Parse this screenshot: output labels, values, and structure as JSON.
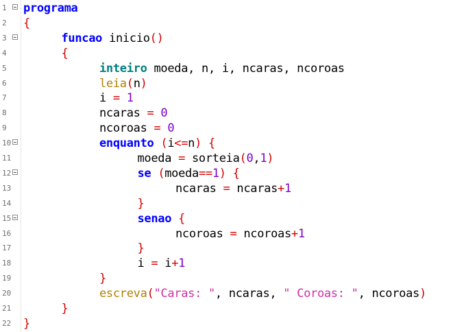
{
  "editor": {
    "colors": {
      "keyword": "#0000ff",
      "type": "#008080",
      "builtin_function": "#b08000",
      "number": "#7b00c8",
      "string": "#d12ea6",
      "operator_bracket": "#d00000",
      "identifier": "#000000",
      "line_number": "#6f6f6f"
    },
    "lines": [
      {
        "no": "1",
        "fold": true,
        "indent": 0,
        "tokens": [
          {
            "t": "kw",
            "v": "programa"
          }
        ]
      },
      {
        "no": "2",
        "fold": false,
        "indent": 0,
        "tokens": [
          {
            "t": "br",
            "v": "{"
          }
        ]
      },
      {
        "no": "3",
        "fold": true,
        "indent": 1,
        "tokens": [
          {
            "t": "kw",
            "v": "funcao"
          },
          {
            "t": "pl",
            "v": " "
          },
          {
            "t": "id",
            "v": "inicio"
          },
          {
            "t": "br",
            "v": "()"
          }
        ]
      },
      {
        "no": "4",
        "fold": false,
        "indent": 1,
        "tokens": [
          {
            "t": "br",
            "v": "{"
          }
        ]
      },
      {
        "no": "5",
        "fold": false,
        "indent": 2,
        "tokens": [
          {
            "t": "ty",
            "v": "inteiro"
          },
          {
            "t": "pl",
            "v": " "
          },
          {
            "t": "id",
            "v": "moeda"
          },
          {
            "t": "pl",
            "v": ", "
          },
          {
            "t": "id",
            "v": "n"
          },
          {
            "t": "pl",
            "v": ", "
          },
          {
            "t": "id",
            "v": "i"
          },
          {
            "t": "pl",
            "v": ", "
          },
          {
            "t": "id",
            "v": "ncaras"
          },
          {
            "t": "pl",
            "v": ", "
          },
          {
            "t": "id",
            "v": "ncoroas"
          }
        ]
      },
      {
        "no": "6",
        "fold": false,
        "indent": 2,
        "tokens": [
          {
            "t": "fn",
            "v": "leia"
          },
          {
            "t": "br",
            "v": "("
          },
          {
            "t": "id",
            "v": "n"
          },
          {
            "t": "br",
            "v": ")"
          }
        ]
      },
      {
        "no": "7",
        "fold": false,
        "indent": 2,
        "tokens": [
          {
            "t": "id",
            "v": "i"
          },
          {
            "t": "pl",
            "v": " "
          },
          {
            "t": "op",
            "v": "="
          },
          {
            "t": "pl",
            "v": " "
          },
          {
            "t": "num",
            "v": "1"
          }
        ]
      },
      {
        "no": "8",
        "fold": false,
        "indent": 2,
        "tokens": [
          {
            "t": "id",
            "v": "ncaras"
          },
          {
            "t": "pl",
            "v": " "
          },
          {
            "t": "op",
            "v": "="
          },
          {
            "t": "pl",
            "v": " "
          },
          {
            "t": "num",
            "v": "0"
          }
        ]
      },
      {
        "no": "9",
        "fold": false,
        "indent": 2,
        "tokens": [
          {
            "t": "id",
            "v": "ncoroas"
          },
          {
            "t": "pl",
            "v": " "
          },
          {
            "t": "op",
            "v": "="
          },
          {
            "t": "pl",
            "v": " "
          },
          {
            "t": "num",
            "v": "0"
          }
        ]
      },
      {
        "no": "10",
        "fold": true,
        "indent": 2,
        "tokens": [
          {
            "t": "kw",
            "v": "enquanto"
          },
          {
            "t": "pl",
            "v": " "
          },
          {
            "t": "br",
            "v": "("
          },
          {
            "t": "id",
            "v": "i"
          },
          {
            "t": "op",
            "v": "<="
          },
          {
            "t": "id",
            "v": "n"
          },
          {
            "t": "br",
            "v": ")"
          },
          {
            "t": "pl",
            "v": " "
          },
          {
            "t": "br",
            "v": "{"
          }
        ]
      },
      {
        "no": "11",
        "fold": false,
        "indent": 3,
        "tokens": [
          {
            "t": "id",
            "v": "moeda"
          },
          {
            "t": "pl",
            "v": " "
          },
          {
            "t": "op",
            "v": "="
          },
          {
            "t": "pl",
            "v": " "
          },
          {
            "t": "id",
            "v": "sorteia"
          },
          {
            "t": "br",
            "v": "("
          },
          {
            "t": "num",
            "v": "0"
          },
          {
            "t": "pl",
            "v": ","
          },
          {
            "t": "num",
            "v": "1"
          },
          {
            "t": "br",
            "v": ")"
          }
        ]
      },
      {
        "no": "12",
        "fold": true,
        "indent": 3,
        "tokens": [
          {
            "t": "kw",
            "v": "se"
          },
          {
            "t": "pl",
            "v": " "
          },
          {
            "t": "br",
            "v": "("
          },
          {
            "t": "id",
            "v": "moeda"
          },
          {
            "t": "op",
            "v": "=="
          },
          {
            "t": "num",
            "v": "1"
          },
          {
            "t": "br",
            "v": ")"
          },
          {
            "t": "pl",
            "v": " "
          },
          {
            "t": "br",
            "v": "{"
          }
        ]
      },
      {
        "no": "13",
        "fold": false,
        "indent": 4,
        "tokens": [
          {
            "t": "id",
            "v": "ncaras"
          },
          {
            "t": "pl",
            "v": " "
          },
          {
            "t": "op",
            "v": "="
          },
          {
            "t": "pl",
            "v": " "
          },
          {
            "t": "id",
            "v": "ncaras"
          },
          {
            "t": "op",
            "v": "+"
          },
          {
            "t": "num",
            "v": "1"
          }
        ]
      },
      {
        "no": "14",
        "fold": false,
        "indent": 3,
        "tokens": [
          {
            "t": "br",
            "v": "}"
          }
        ]
      },
      {
        "no": "15",
        "fold": true,
        "indent": 3,
        "tokens": [
          {
            "t": "kw",
            "v": "senao"
          },
          {
            "t": "pl",
            "v": " "
          },
          {
            "t": "br",
            "v": "{"
          }
        ]
      },
      {
        "no": "16",
        "fold": false,
        "indent": 4,
        "tokens": [
          {
            "t": "id",
            "v": "ncoroas"
          },
          {
            "t": "pl",
            "v": " "
          },
          {
            "t": "op",
            "v": "="
          },
          {
            "t": "pl",
            "v": " "
          },
          {
            "t": "id",
            "v": "ncoroas"
          },
          {
            "t": "op",
            "v": "+"
          },
          {
            "t": "num",
            "v": "1"
          }
        ]
      },
      {
        "no": "17",
        "fold": false,
        "indent": 3,
        "tokens": [
          {
            "t": "br",
            "v": "}"
          }
        ]
      },
      {
        "no": "18",
        "fold": false,
        "indent": 3,
        "tokens": [
          {
            "t": "id",
            "v": "i"
          },
          {
            "t": "pl",
            "v": " "
          },
          {
            "t": "op",
            "v": "="
          },
          {
            "t": "pl",
            "v": " "
          },
          {
            "t": "id",
            "v": "i"
          },
          {
            "t": "op",
            "v": "+"
          },
          {
            "t": "num",
            "v": "1"
          }
        ]
      },
      {
        "no": "19",
        "fold": false,
        "indent": 2,
        "tokens": [
          {
            "t": "br",
            "v": "}"
          }
        ]
      },
      {
        "no": "20",
        "fold": false,
        "indent": 2,
        "tokens": [
          {
            "t": "fn",
            "v": "escreva"
          },
          {
            "t": "br",
            "v": "("
          },
          {
            "t": "str",
            "v": "\"Caras: \""
          },
          {
            "t": "pl",
            "v": ", "
          },
          {
            "t": "id",
            "v": "ncaras"
          },
          {
            "t": "pl",
            "v": ", "
          },
          {
            "t": "str",
            "v": "\" Coroas: \""
          },
          {
            "t": "pl",
            "v": ", "
          },
          {
            "t": "id",
            "v": "ncoroas"
          },
          {
            "t": "br",
            "v": ")"
          }
        ]
      },
      {
        "no": "21",
        "fold": false,
        "indent": 1,
        "tokens": [
          {
            "t": "br",
            "v": "}"
          }
        ]
      },
      {
        "no": "22",
        "fold": false,
        "indent": 0,
        "tokens": [
          {
            "t": "br",
            "v": "}"
          }
        ]
      }
    ]
  }
}
